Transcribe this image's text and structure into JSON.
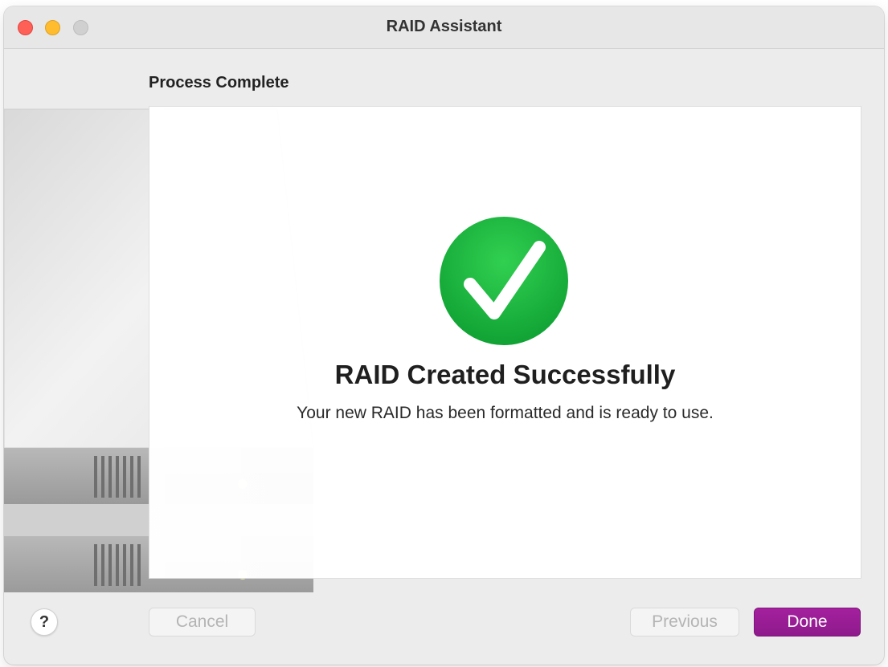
{
  "window": {
    "title": "RAID Assistant"
  },
  "page": {
    "section_title": "Process Complete",
    "headline": "RAID Created Successfully",
    "message": "Your new RAID has been formatted and is ready to use."
  },
  "icons": {
    "success": "checkmark-circle-icon",
    "help": "question-mark-icon",
    "illustration": "drive-stack-illustration"
  },
  "buttons": {
    "help_label": "?",
    "cancel_label": "Cancel",
    "previous_label": "Previous",
    "done_label": "Done"
  },
  "colors": {
    "accent": "#9a1e98",
    "success": "#12b33a",
    "close": "#fe5f57",
    "minimize": "#febc2e"
  }
}
